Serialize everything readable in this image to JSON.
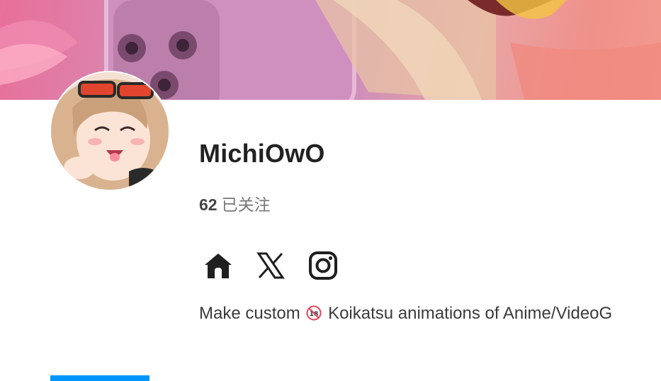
{
  "profile": {
    "username": "MichiOwO",
    "following_count": "62",
    "following_label": "已关注",
    "bio_prefix": "Make custom",
    "bio_icon": "r18-badge-icon",
    "bio_suffix": "Koikatsu animations of Anime/VideoG"
  },
  "social_links": [
    {
      "name": "home",
      "icon": "home-icon"
    },
    {
      "name": "x",
      "icon": "x-logo-icon"
    },
    {
      "name": "instagram",
      "icon": "instagram-icon"
    }
  ],
  "colors": {
    "accent": "#0096fa",
    "text_primary": "#222222",
    "text_secondary": "#777777"
  }
}
